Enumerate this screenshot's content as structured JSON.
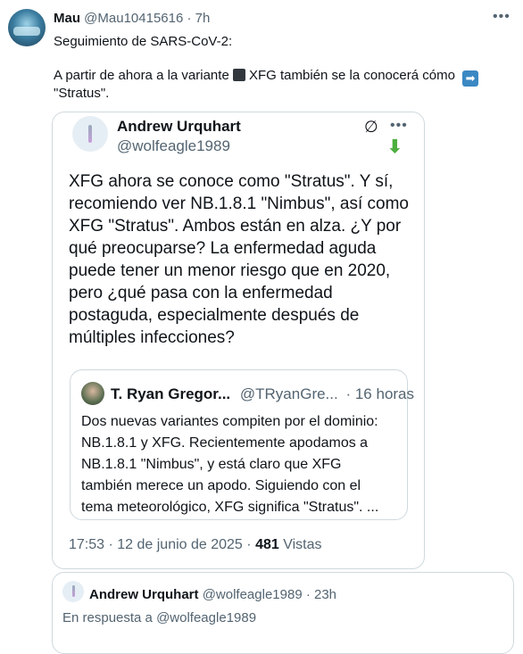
{
  "tweet": {
    "author_name": "Mau",
    "handle": "@Mau10415616",
    "separator": "·",
    "time": "7h",
    "line1": "Seguimiento de SARS-CoV-2:",
    "line2_before": "A partir de ahora a la variante",
    "line2_after": "XFG también se la conocerá cómo",
    "line3": "\"Stratus\".",
    "more_icon": "more-horizontal-icon"
  },
  "quoted_tweet": {
    "author_name": "Andrew Urquhart",
    "handle": "@wolfeagle1989",
    "lines": [
      "XFG ahora se conoce como \"Stratus\". Y sí,",
      "recomiendo ver NB.1.8.1 \"Nimbus\", así como",
      "XFG \"Stratus\". Ambos están en alza. ¿Y por",
      "qué preocuparse? La enfermedad aguda",
      "puede tener un menor riesgo que en 2020,",
      "pero ¿qué pasa con la enfermedad",
      "postaguda, especialmente después de",
      "múltiples infecciones?"
    ],
    "timestamp": "17:53 · 12 de junio de 2025 ·",
    "views_count": "481",
    "views_label": "Vistas"
  },
  "nested_quote": {
    "author_name": "T. Ryan Gregor...",
    "handle": "@TRyanGre...",
    "time": "· 16 horas",
    "lines": [
      "Dos nuevas variantes compiten por el dominio:",
      "NB.1.8.1 y XFG. Recientemente apodamos a",
      "NB.1.8.1 \"Nimbus\", y está claro que XFG",
      "también merece un apodo. Siguiendo con el",
      "tema meteorológico, XFG significa \"Stratus\". ..."
    ]
  },
  "reply_tweet": {
    "author_name": "Andrew Urquhart",
    "handle_time": "@wolfeagle1989 · 23h",
    "reply_to": "En respuesta a @wolfeagle1989"
  }
}
